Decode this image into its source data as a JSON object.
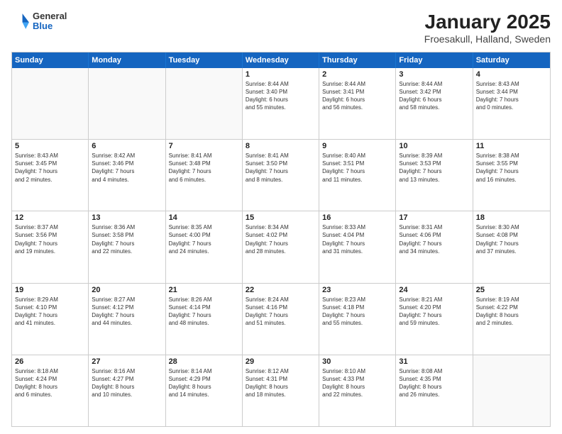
{
  "header": {
    "logo": {
      "line1": "General",
      "line2": "Blue"
    },
    "title": "January 2025",
    "subtitle": "Froesakull, Halland, Sweden"
  },
  "weekdays": [
    "Sunday",
    "Monday",
    "Tuesday",
    "Wednesday",
    "Thursday",
    "Friday",
    "Saturday"
  ],
  "rows": [
    [
      {
        "day": "",
        "text": ""
      },
      {
        "day": "",
        "text": ""
      },
      {
        "day": "",
        "text": ""
      },
      {
        "day": "1",
        "text": "Sunrise: 8:44 AM\nSunset: 3:40 PM\nDaylight: 6 hours\nand 55 minutes."
      },
      {
        "day": "2",
        "text": "Sunrise: 8:44 AM\nSunset: 3:41 PM\nDaylight: 6 hours\nand 56 minutes."
      },
      {
        "day": "3",
        "text": "Sunrise: 8:44 AM\nSunset: 3:42 PM\nDaylight: 6 hours\nand 58 minutes."
      },
      {
        "day": "4",
        "text": "Sunrise: 8:43 AM\nSunset: 3:44 PM\nDaylight: 7 hours\nand 0 minutes."
      }
    ],
    [
      {
        "day": "5",
        "text": "Sunrise: 8:43 AM\nSunset: 3:45 PM\nDaylight: 7 hours\nand 2 minutes."
      },
      {
        "day": "6",
        "text": "Sunrise: 8:42 AM\nSunset: 3:46 PM\nDaylight: 7 hours\nand 4 minutes."
      },
      {
        "day": "7",
        "text": "Sunrise: 8:41 AM\nSunset: 3:48 PM\nDaylight: 7 hours\nand 6 minutes."
      },
      {
        "day": "8",
        "text": "Sunrise: 8:41 AM\nSunset: 3:50 PM\nDaylight: 7 hours\nand 8 minutes."
      },
      {
        "day": "9",
        "text": "Sunrise: 8:40 AM\nSunset: 3:51 PM\nDaylight: 7 hours\nand 11 minutes."
      },
      {
        "day": "10",
        "text": "Sunrise: 8:39 AM\nSunset: 3:53 PM\nDaylight: 7 hours\nand 13 minutes."
      },
      {
        "day": "11",
        "text": "Sunrise: 8:38 AM\nSunset: 3:55 PM\nDaylight: 7 hours\nand 16 minutes."
      }
    ],
    [
      {
        "day": "12",
        "text": "Sunrise: 8:37 AM\nSunset: 3:56 PM\nDaylight: 7 hours\nand 19 minutes."
      },
      {
        "day": "13",
        "text": "Sunrise: 8:36 AM\nSunset: 3:58 PM\nDaylight: 7 hours\nand 22 minutes."
      },
      {
        "day": "14",
        "text": "Sunrise: 8:35 AM\nSunset: 4:00 PM\nDaylight: 7 hours\nand 24 minutes."
      },
      {
        "day": "15",
        "text": "Sunrise: 8:34 AM\nSunset: 4:02 PM\nDaylight: 7 hours\nand 28 minutes."
      },
      {
        "day": "16",
        "text": "Sunrise: 8:33 AM\nSunset: 4:04 PM\nDaylight: 7 hours\nand 31 minutes."
      },
      {
        "day": "17",
        "text": "Sunrise: 8:31 AM\nSunset: 4:06 PM\nDaylight: 7 hours\nand 34 minutes."
      },
      {
        "day": "18",
        "text": "Sunrise: 8:30 AM\nSunset: 4:08 PM\nDaylight: 7 hours\nand 37 minutes."
      }
    ],
    [
      {
        "day": "19",
        "text": "Sunrise: 8:29 AM\nSunset: 4:10 PM\nDaylight: 7 hours\nand 41 minutes."
      },
      {
        "day": "20",
        "text": "Sunrise: 8:27 AM\nSunset: 4:12 PM\nDaylight: 7 hours\nand 44 minutes."
      },
      {
        "day": "21",
        "text": "Sunrise: 8:26 AM\nSunset: 4:14 PM\nDaylight: 7 hours\nand 48 minutes."
      },
      {
        "day": "22",
        "text": "Sunrise: 8:24 AM\nSunset: 4:16 PM\nDaylight: 7 hours\nand 51 minutes."
      },
      {
        "day": "23",
        "text": "Sunrise: 8:23 AM\nSunset: 4:18 PM\nDaylight: 7 hours\nand 55 minutes."
      },
      {
        "day": "24",
        "text": "Sunrise: 8:21 AM\nSunset: 4:20 PM\nDaylight: 7 hours\nand 59 minutes."
      },
      {
        "day": "25",
        "text": "Sunrise: 8:19 AM\nSunset: 4:22 PM\nDaylight: 8 hours\nand 2 minutes."
      }
    ],
    [
      {
        "day": "26",
        "text": "Sunrise: 8:18 AM\nSunset: 4:24 PM\nDaylight: 8 hours\nand 6 minutes."
      },
      {
        "day": "27",
        "text": "Sunrise: 8:16 AM\nSunset: 4:27 PM\nDaylight: 8 hours\nand 10 minutes."
      },
      {
        "day": "28",
        "text": "Sunrise: 8:14 AM\nSunset: 4:29 PM\nDaylight: 8 hours\nand 14 minutes."
      },
      {
        "day": "29",
        "text": "Sunrise: 8:12 AM\nSunset: 4:31 PM\nDaylight: 8 hours\nand 18 minutes."
      },
      {
        "day": "30",
        "text": "Sunrise: 8:10 AM\nSunset: 4:33 PM\nDaylight: 8 hours\nand 22 minutes."
      },
      {
        "day": "31",
        "text": "Sunrise: 8:08 AM\nSunset: 4:35 PM\nDaylight: 8 hours\nand 26 minutes."
      },
      {
        "day": "",
        "text": ""
      }
    ]
  ]
}
